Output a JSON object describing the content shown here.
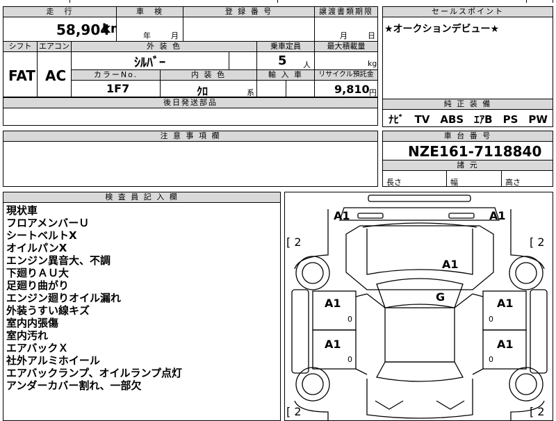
{
  "headers": {
    "mileage": "走　行",
    "inspection": "車　検",
    "registration_no": "登 録 番 号",
    "transfer_docs": "譲渡書類期限",
    "sales_point": "セールスポイント",
    "shift": "シフト",
    "aircon": "エアコン",
    "exterior_color": "外 装 色",
    "capacity": "乗車定員",
    "max_load": "最大積載量",
    "color_no": "カラーNo.",
    "interior_color": "内 装 色",
    "import": "輸 入 車",
    "recycle": "リサイクル預託金",
    "deferred_parts": "後日発送部品",
    "genuine_equipment": "純 正 装 備",
    "caution": "注 意 事 項 欄",
    "chassis_no": "車 台 番 号",
    "dimensions": "諸 元",
    "inspector_notes": "検 査 員 記 入 欄"
  },
  "vehicle": {
    "mileage_value": "58,904",
    "mileage_unit": "km",
    "inspection_year_unit": "年",
    "inspection_month_unit": "月",
    "transfer_month_unit": "月",
    "transfer_day_unit": "日",
    "shift": "FAT",
    "aircon": "AC",
    "exterior_color": "ｼﾙﾊﾞｰ",
    "capacity": "5",
    "capacity_unit": "人",
    "load_unit": "kg",
    "color_no": "1F7",
    "interior_color": "ｸﾛ",
    "interior_suffix": "系",
    "recycle_fee": "9,810",
    "recycle_unit": "円",
    "sales_point": "★オークションデビュー★",
    "genuine_equipment": "ﾅﾋﾞ　TV　ABS　ｴｱB　PS　PW",
    "chassis_no": "NZE161-7118840",
    "dim_length": "長さ",
    "dim_width": "幅",
    "dim_height": "高さ"
  },
  "inspector_notes": [
    "現状車",
    "フロアメンバーＵ",
    "シートベルトX",
    "オイルパンX",
    "エンジン異音大、不調",
    "下廻りＡＵ大",
    "足廻り曲がり",
    "エンジン廻りオイル漏れ",
    "外装うすい線キズ",
    "室内内張傷",
    "室内汚れ",
    "エアバックＸ",
    "社外アルミホイール",
    "エアバックランプ、オイルランプ点灯",
    "アンダーカバー割れ、一部欠"
  ],
  "diagram_marks": {
    "front_left": "A1",
    "front_right": "A1",
    "hood": "A1",
    "roof": "G",
    "left_door_front": "A1",
    "right_door_front": "A1",
    "left_door_rear": "A1",
    "right_door_rear": "A1",
    "tire_fl": "[ 2",
    "tire_fr": "[ 2",
    "tire_rl": "[ 2",
    "tire_rr": "[ 2",
    "zero_1": "0",
    "zero_2": "0",
    "zero_3": "0",
    "zero_4": "0"
  }
}
